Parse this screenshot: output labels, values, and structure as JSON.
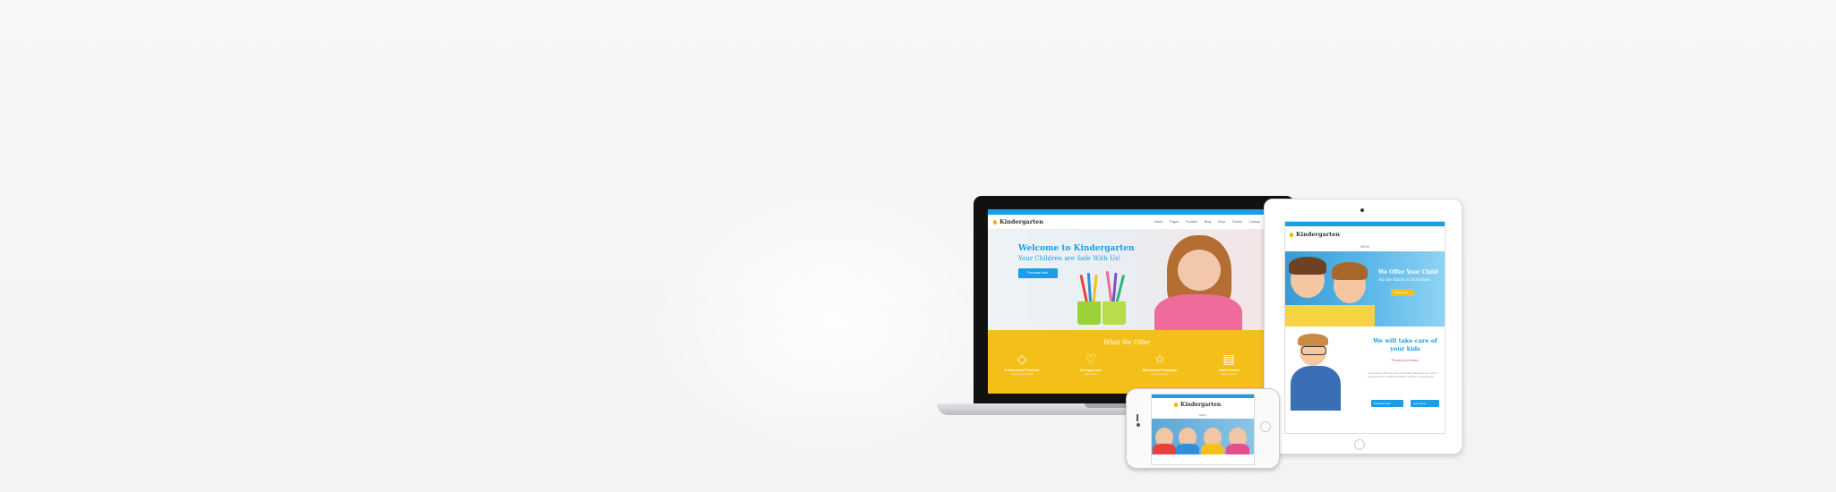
{
  "site": {
    "logo": "Kindergarten",
    "nav_links": [
      "Home",
      "Pages",
      "Portfolio",
      "Blog",
      "Shop",
      "Events",
      "Contact"
    ],
    "menu_label": "MENU"
  },
  "laptop": {
    "hero_title": "Welcome to Kindergarten",
    "hero_subtitle": "Your Children are Safe With Us!",
    "hero_button": "Purchase Now",
    "offer_title": "What We Offer",
    "offers": [
      {
        "icon": "diamond-icon",
        "glyph": "◇",
        "label": "Professional Teachers",
        "sub": "Experienced Staff"
      },
      {
        "icon": "heart-icon",
        "glyph": "♡",
        "label": "Our Approach",
        "sub": "Care Plan"
      },
      {
        "icon": "star-icon",
        "glyph": "☆",
        "label": "Educational Programs",
        "sub": "For Every Age"
      },
      {
        "icon": "book-icon",
        "glyph": "▤",
        "label": "Latest Events",
        "sub": "School News"
      }
    ]
  },
  "tablet": {
    "hero_title": "We Offer Your Child",
    "hero_subtitle": "All the Kinds of Activities",
    "hero_button": "Read More",
    "care_title": "We will take care of your kids",
    "care_mid": "Precise information",
    "care_text": "Lorem ipsum dolor sit amet, consectetur adipiscing elit, sed do eiusmod tempor incididunt ut labore et dolore magna aliqua.",
    "btn_left": "Purchase Now",
    "btn_right": "Learn More"
  },
  "colors": {
    "accent_blue": "#1a9ee6",
    "accent_yellow": "#f5bf1a",
    "accent_pink": "#e44f8b"
  }
}
